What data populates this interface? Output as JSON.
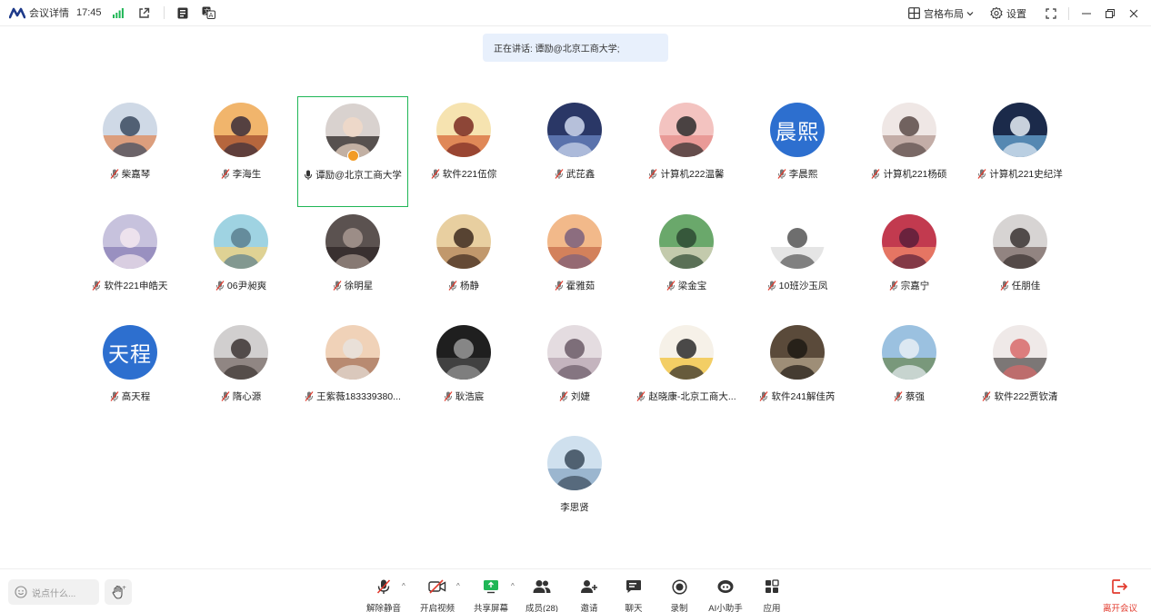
{
  "titlebar": {
    "meeting_info": "会议详情",
    "time": "17:45",
    "layout_label": "宫格布局",
    "settings_label": "设置"
  },
  "speaking_banner": "正在讲话: 谭励@北京工商大学;",
  "participants": [
    {
      "name": "柴嘉琴",
      "avatar": "photo"
    },
    {
      "name": "李海生",
      "avatar": "photo"
    },
    {
      "name": "谭励@北京工商大学",
      "avatar": "photo",
      "active": true
    },
    {
      "name": "软件221伍倧",
      "avatar": "photo"
    },
    {
      "name": "武芘鑫",
      "avatar": "photo"
    },
    {
      "name": "计算机222温馨",
      "avatar": "photo"
    },
    {
      "name": "李晨熙",
      "avatar": "text",
      "avatar_text": "晨熙"
    },
    {
      "name": "计算机221杨硕",
      "avatar": "photo"
    },
    {
      "name": "计算机221史纪洋",
      "avatar": "photo"
    },
    {
      "name": "软件221申皓天",
      "avatar": "photo"
    },
    {
      "name": "06尹昶爽",
      "avatar": "photo"
    },
    {
      "name": "徐明星",
      "avatar": "photo"
    },
    {
      "name": "杨静",
      "avatar": "photo"
    },
    {
      "name": "霍雅茹",
      "avatar": "photo"
    },
    {
      "name": "梁金宝",
      "avatar": "photo"
    },
    {
      "name": "10班沙玉凤",
      "avatar": "photo"
    },
    {
      "name": "宗嘉宁",
      "avatar": "photo"
    },
    {
      "name": "任朋佳",
      "avatar": "photo"
    },
    {
      "name": "高天程",
      "avatar": "text",
      "avatar_text": "天程"
    },
    {
      "name": "隋心源",
      "avatar": "photo"
    },
    {
      "name": "王紫薇183339380...",
      "avatar": "photo"
    },
    {
      "name": "耿浩宸",
      "avatar": "photo"
    },
    {
      "name": "刘婕",
      "avatar": "photo"
    },
    {
      "name": "赵晓康-北京工商大...",
      "avatar": "photo"
    },
    {
      "name": "软件241解佳芮",
      "avatar": "photo"
    },
    {
      "name": "蔡强",
      "avatar": "photo"
    },
    {
      "name": "软件222贾钦清",
      "avatar": "photo"
    },
    {
      "name": "李思贤",
      "avatar": "photo"
    }
  ],
  "bottom": {
    "say_placeholder": "说点什么...",
    "unmute": "解除静音",
    "start_video": "开启视频",
    "share_screen": "共享屏幕",
    "members": "成员(28)",
    "invite": "邀请",
    "chat": "聊天",
    "record": "录制",
    "ai_assistant": "AI小助手",
    "apps": "应用",
    "leave": "离开会议"
  },
  "colors": {
    "accent_green": "#1fb656",
    "leave_red": "#e23b2e",
    "banner_bg": "#e8f0fc",
    "text_avatar_bg": "#2d6fcf"
  }
}
